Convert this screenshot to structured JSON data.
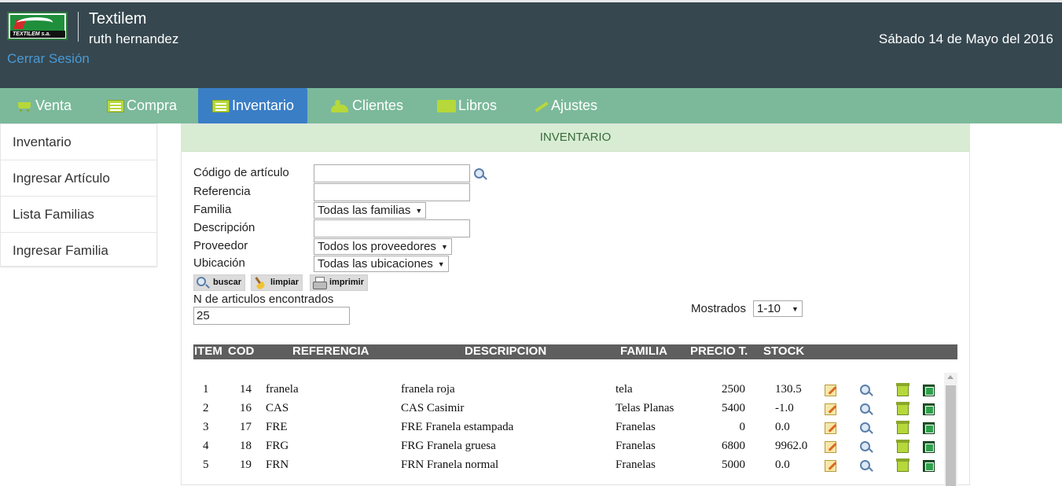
{
  "header": {
    "logo_text": "TEXTILEM s.a.",
    "app_title": "Textilem",
    "user_name": "ruth hernandez",
    "logout_label": "Cerrar Sesión",
    "date": "Sábado 14 de Mayo del 2016"
  },
  "nav": {
    "items": [
      {
        "label": "Venta",
        "icon": "cart-icon"
      },
      {
        "label": "Compra",
        "icon": "list-icon"
      },
      {
        "label": "Inventario",
        "icon": "list-icon",
        "active": true
      },
      {
        "label": "Clientes",
        "icon": "people-icon"
      },
      {
        "label": "Libros",
        "icon": "folder-icon"
      },
      {
        "label": "Ajustes",
        "icon": "wrench-icon"
      }
    ],
    "active_color": "#3a7ec6",
    "bar_color": "#7bb99a"
  },
  "sidebar": {
    "items": [
      {
        "label": "Inventario"
      },
      {
        "label": "Ingresar Artículo"
      },
      {
        "label": "Lista Familias"
      },
      {
        "label": "Ingresar Familia"
      }
    ]
  },
  "panel": {
    "title": "INVENTARIO",
    "form": {
      "codigo_label": "Código de artículo",
      "codigo_value": "",
      "referencia_label": "Referencia",
      "referencia_value": "",
      "familia_label": "Familia",
      "familia_value": "Todas las familias",
      "descripcion_label": "Descripción",
      "descripcion_value": "",
      "proveedor_label": "Proveedor",
      "proveedor_value": "Todos los proveedores",
      "ubicacion_label": "Ubicación",
      "ubicacion_value": "Todas las ubicaciones"
    },
    "buttons": {
      "buscar": "buscar",
      "limpiar": "limpiar",
      "imprimir": "imprimir"
    },
    "found_label": "N de articulos encontrados",
    "found_value": "25",
    "shown_label": "Mostrados",
    "shown_value": "1-10",
    "table": {
      "headers": [
        "ITEM",
        "COD",
        "REFERENCIA",
        "DESCRIPCION",
        "FAMILIA",
        "PRECIO T.",
        "STOCK"
      ],
      "rows": [
        {
          "item": "1",
          "cod": "14",
          "ref": "franela",
          "desc": "franela roja",
          "fam": "tela",
          "precio": "2500",
          "stock": "130.5"
        },
        {
          "item": "2",
          "cod": "16",
          "ref": "CAS",
          "desc": "CAS Casimir",
          "fam": "Telas Planas",
          "precio": "5400",
          "stock": "-1.0"
        },
        {
          "item": "3",
          "cod": "17",
          "ref": "FRE",
          "desc": "FRE Franela estampada",
          "fam": "Franelas",
          "precio": "0",
          "stock": "0.0"
        },
        {
          "item": "4",
          "cod": "18",
          "ref": "FRG",
          "desc": "FRG Franela gruesa",
          "fam": "Franelas",
          "precio": "6800",
          "stock": "9962.0"
        },
        {
          "item": "5",
          "cod": "19",
          "ref": "FRN",
          "desc": "FRN Franela normal",
          "fam": "Franelas",
          "precio": "5000",
          "stock": "0.0"
        }
      ]
    }
  }
}
